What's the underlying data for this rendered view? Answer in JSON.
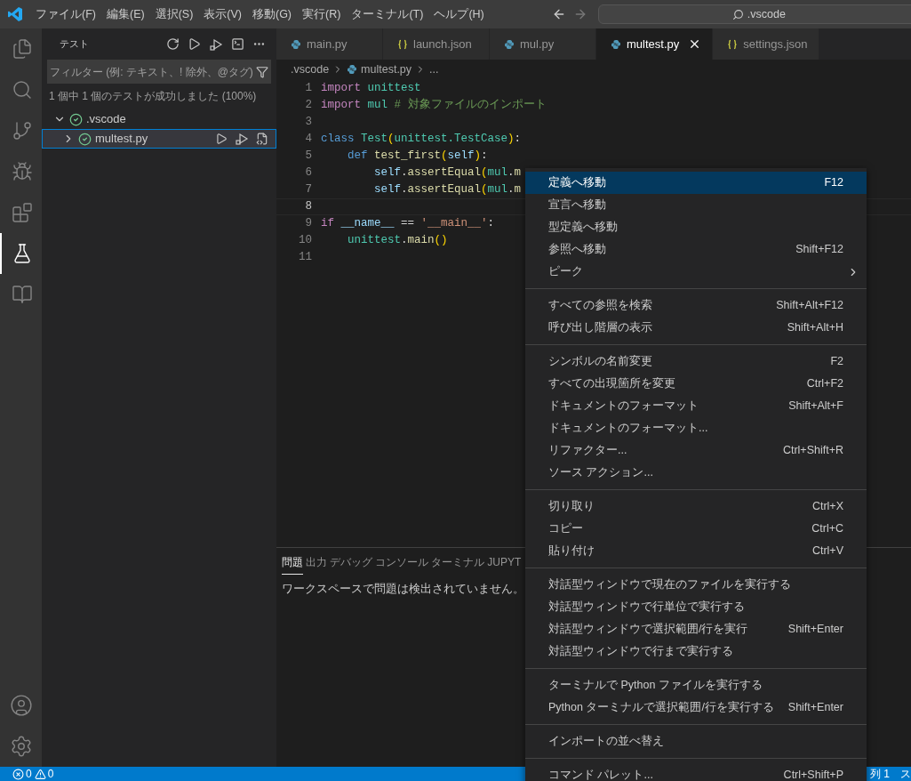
{
  "menu_bar": [
    "ファイル(F)",
    "編集(E)",
    "選択(S)",
    "表示(V)",
    "移動(G)",
    "実行(R)",
    "ターミナル(T)",
    "ヘルプ(H)"
  ],
  "command_center": {
    "value": ".vscode"
  },
  "activity_bar": [
    {
      "selected": false
    },
    {
      "selected": false
    },
    {
      "selected": false
    },
    {
      "selected": false
    },
    {
      "selected": false
    },
    {
      "selected": true
    },
    {
      "selected": false
    }
  ],
  "sidebar": {
    "title": "テスト",
    "filter": {
      "placeholder": "フィルター (例: テキスト、! 除外、@タグ)"
    },
    "summary": "1 個中 1 個のテストが成功しました (100%)",
    "tree": [
      {
        "label": ".vscode",
        "expanded": true,
        "passed": true,
        "selected": false,
        "children": [
          {
            "label": "multest.py",
            "expanded": false,
            "passed": true,
            "selected": true
          }
        ]
      }
    ]
  },
  "tabs": [
    {
      "label": "main.py",
      "kind": "python",
      "selected": false
    },
    {
      "label": "launch.json",
      "kind": "json",
      "selected": false
    },
    {
      "label": "mul.py",
      "kind": "python",
      "selected": false
    },
    {
      "label": "multest.py",
      "kind": "python",
      "selected": true
    },
    {
      "label": "settings.json",
      "kind": "json",
      "selected": false
    }
  ],
  "breadcrumb": [
    ".vscode",
    "multest.py",
    "..."
  ],
  "code": [
    {
      "number": "1",
      "tokens": [
        {
          "kind": "keyword",
          "text": "import"
        },
        {
          "kind": "module",
          "text": " unittest"
        }
      ]
    },
    {
      "number": "2",
      "tokens": [
        {
          "kind": "keyword",
          "text": "import"
        },
        {
          "kind": "module",
          "text": " mul"
        },
        {
          "kind": "comment",
          "text": " # 対象ファイルのインポート"
        }
      ]
    },
    {
      "number": "3"
    },
    {
      "number": "4",
      "tokens": [
        {
          "kind": "def",
          "text": "class"
        },
        {
          "kind": "module",
          "text": " Test"
        },
        {
          "kind": "bracket",
          "text": "("
        },
        {
          "kind": "module",
          "text": "unittest.TestCase"
        },
        {
          "kind": "bracket",
          "text": ")"
        },
        {
          "kind": "plain",
          "text": ":"
        }
      ]
    },
    {
      "number": "5",
      "tokens": [
        {
          "kind": "def",
          "text": "    def"
        },
        {
          "kind": "func",
          "text": " test_first"
        },
        {
          "kind": "bracket",
          "text": "("
        },
        {
          "kind": "param",
          "text": "self"
        },
        {
          "kind": "bracket",
          "text": ")"
        },
        {
          "kind": "plain",
          "text": ":"
        }
      ]
    },
    {
      "number": "6",
      "tokens": [
        {
          "kind": "param",
          "text": "        self"
        },
        {
          "kind": "plain",
          "text": "."
        },
        {
          "kind": "func",
          "text": "assertEqual"
        },
        {
          "kind": "bracket",
          "text": "("
        },
        {
          "kind": "module",
          "text": "mul"
        },
        {
          "kind": "plain",
          "text": "."
        },
        {
          "kind": "func",
          "text": "m"
        }
      ]
    },
    {
      "number": "7",
      "tokens": [
        {
          "kind": "param",
          "text": "        self"
        },
        {
          "kind": "plain",
          "text": "."
        },
        {
          "kind": "func",
          "text": "assertEqual"
        },
        {
          "kind": "bracket",
          "text": "("
        },
        {
          "kind": "module",
          "text": "mul"
        },
        {
          "kind": "plain",
          "text": "."
        },
        {
          "kind": "func",
          "text": "m"
        }
      ]
    },
    {
      "number": "8"
    },
    {
      "number": "9",
      "tokens": [
        {
          "kind": "keyword",
          "text": "if"
        },
        {
          "kind": "param",
          "text": " __name__"
        },
        {
          "kind": "plain",
          "text": " == "
        },
        {
          "kind": "string",
          "text": "'__main__'"
        },
        {
          "kind": "plain",
          "text": ":"
        }
      ]
    },
    {
      "number": "10",
      "tokens": [
        {
          "kind": "module",
          "text": "    unittest"
        },
        {
          "kind": "plain",
          "text": "."
        },
        {
          "kind": "func",
          "text": "main"
        },
        {
          "kind": "bracket",
          "text": "()"
        }
      ]
    },
    {
      "number": "11"
    }
  ],
  "panel": {
    "tabs": [
      {
        "label": "問題",
        "selected": true
      },
      {
        "label": "出力",
        "selected": false
      },
      {
        "label": "デバッグ コンソール",
        "selected": false
      },
      {
        "label": "ターミナル",
        "selected": false
      },
      {
        "label": "JUPYT",
        "selected": false
      }
    ],
    "message": "ワークスペースで問題は検出されていません。"
  },
  "context_menu": [
    {
      "kind": "item",
      "label": "定義へ移動",
      "shortcut": "F12",
      "selected": true
    },
    {
      "kind": "item",
      "label": "宣言へ移動",
      "selected": false
    },
    {
      "kind": "item",
      "label": "型定義へ移動",
      "selected": false
    },
    {
      "kind": "item",
      "label": "参照へ移動",
      "shortcut": "Shift+F12",
      "selected": false
    },
    {
      "kind": "submenu",
      "label": "ピーク",
      "selected": false
    },
    {
      "kind": "separator"
    },
    {
      "kind": "item",
      "label": "すべての参照を検索",
      "shortcut": "Shift+Alt+F12",
      "selected": false
    },
    {
      "kind": "item",
      "label": "呼び出し階層の表示",
      "shortcut": "Shift+Alt+H",
      "selected": false
    },
    {
      "kind": "separator"
    },
    {
      "kind": "item",
      "label": "シンボルの名前変更",
      "shortcut": "F2",
      "selected": false
    },
    {
      "kind": "item",
      "label": "すべての出現箇所を変更",
      "shortcut": "Ctrl+F2",
      "selected": false
    },
    {
      "kind": "item",
      "label": "ドキュメントのフォーマット",
      "shortcut": "Shift+Alt+F",
      "selected": false
    },
    {
      "kind": "item",
      "label": "ドキュメントのフォーマット...",
      "selected": false
    },
    {
      "kind": "item",
      "label": "リファクター...",
      "shortcut": "Ctrl+Shift+R",
      "selected": false
    },
    {
      "kind": "item",
      "label": "ソース アクション...",
      "selected": false
    },
    {
      "kind": "separator"
    },
    {
      "kind": "item",
      "label": "切り取り",
      "shortcut": "Ctrl+X",
      "selected": false
    },
    {
      "kind": "item",
      "label": "コピー",
      "shortcut": "Ctrl+C",
      "selected": false
    },
    {
      "kind": "item",
      "label": "貼り付け",
      "shortcut": "Ctrl+V",
      "selected": false
    },
    {
      "kind": "separator"
    },
    {
      "kind": "item",
      "label": "対話型ウィンドウで現在のファイルを実行する",
      "selected": false
    },
    {
      "kind": "item",
      "label": "対話型ウィンドウで行単位で実行する",
      "selected": false
    },
    {
      "kind": "item",
      "label": "対話型ウィンドウで選択範囲/行を実行",
      "shortcut": "Shift+Enter",
      "selected": false
    },
    {
      "kind": "item",
      "label": "対話型ウィンドウで行まで実行する",
      "selected": false
    },
    {
      "kind": "separator"
    },
    {
      "kind": "item",
      "label": "ターミナルで Python ファイルを実行する",
      "selected": false
    },
    {
      "kind": "item",
      "label": "Python ターミナルで選択範囲/行を実行する",
      "shortcut": "Shift+Enter",
      "selected": false
    },
    {
      "kind": "separator"
    },
    {
      "kind": "item",
      "label": "インポートの並べ替え",
      "selected": false
    },
    {
      "kind": "separator"
    },
    {
      "kind": "item",
      "label": "コマンド パレット...",
      "shortcut": "Ctrl+Shift+P",
      "selected": false
    }
  ],
  "status_bar": {
    "errors": "0",
    "warnings": "0",
    "position": "列 1",
    "right_cut": "ス"
  }
}
